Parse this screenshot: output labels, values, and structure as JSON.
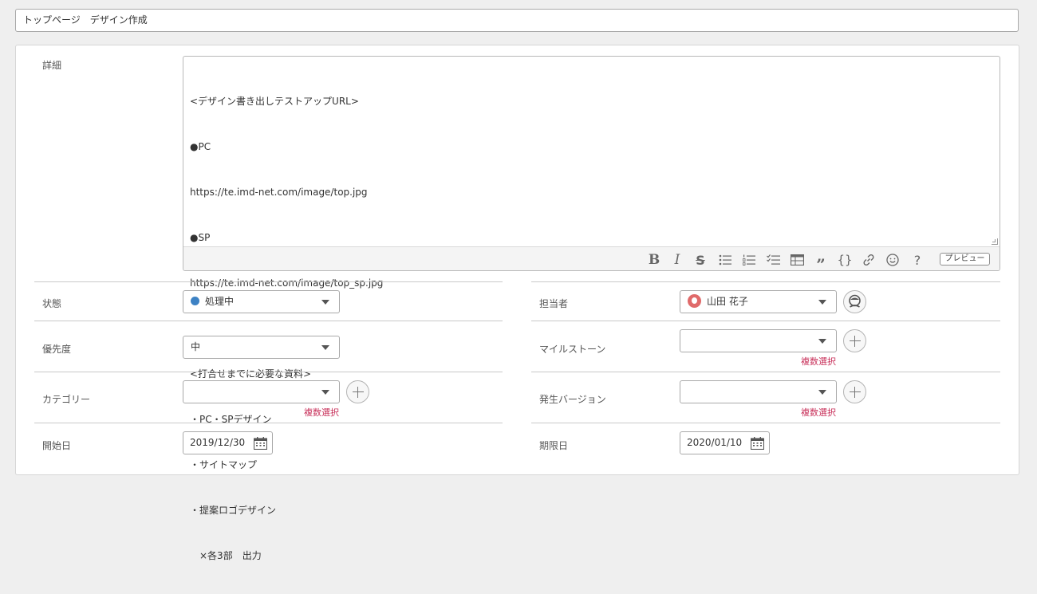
{
  "issue": {
    "summary": "トップページ　デザイン作成"
  },
  "fields": {
    "detail_label": "詳細",
    "status_label": "状態",
    "priority_label": "優先度",
    "category_label": "カテゴリー",
    "start_date_label": "開始日",
    "assignee_label": "担当者",
    "milestone_label": "マイルストーン",
    "version_label": "発生バージョン",
    "due_date_label": "期限日"
  },
  "description": {
    "lines": [
      "<デザイン書き出しテストアップURL>",
      "●PC",
      "https://te.imd-net.com/image/top.jpg",
      "●SP",
      "https://te.imd-net.com/image/top_sp.jpg",
      "",
      "<打合せまでに必要な資料>",
      "・PC・SPデザイン",
      "・サイトマップ",
      "・提案ロゴデザイン",
      "　×各3部　出力"
    ]
  },
  "toolbar": {
    "bold_icon": "bold-icon",
    "italic_icon": "italic-icon",
    "strike_icon": "strikethrough-icon",
    "bullet_icon": "bullet-list-icon",
    "number_icon": "numbered-list-icon",
    "check_icon": "checklist-icon",
    "table_icon": "table-icon",
    "quote_icon": "quote-icon",
    "code_icon": "code-icon",
    "link_icon": "link-icon",
    "emoji_icon": "emoji-icon",
    "help_icon": "help-icon",
    "preview_label": "プレビュー"
  },
  "values": {
    "status": "処理中",
    "status_color": "#3d82c4",
    "priority": "中",
    "category": "",
    "start_date": "2019/12/30",
    "assignee": "山田 花子",
    "milestone": "",
    "version": "",
    "due_date": "2020/01/10"
  },
  "multi_select_label": "複数選択"
}
